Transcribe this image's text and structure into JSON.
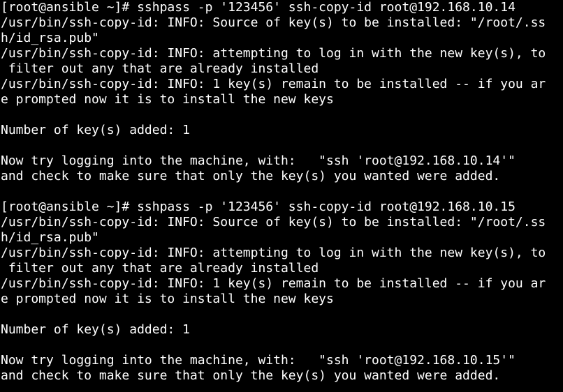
{
  "terminal": {
    "lines": [
      "[root@ansible ~]# sshpass -p '123456' ssh-copy-id root@192.168.10.14",
      "/usr/bin/ssh-copy-id: INFO: Source of key(s) to be installed: \"/root/.ss",
      "h/id_rsa.pub\"",
      "/usr/bin/ssh-copy-id: INFO: attempting to log in with the new key(s), to",
      " filter out any that are already installed",
      "/usr/bin/ssh-copy-id: INFO: 1 key(s) remain to be installed -- if you ar",
      "e prompted now it is to install the new keys",
      "",
      "Number of key(s) added: 1",
      "",
      "Now try logging into the machine, with:   \"ssh 'root@192.168.10.14'\"",
      "and check to make sure that only the key(s) you wanted were added.",
      "",
      "[root@ansible ~]# sshpass -p '123456' ssh-copy-id root@192.168.10.15",
      "/usr/bin/ssh-copy-id: INFO: Source of key(s) to be installed: \"/root/.ss",
      "h/id_rsa.pub\"",
      "/usr/bin/ssh-copy-id: INFO: attempting to log in with the new key(s), to",
      " filter out any that are already installed",
      "/usr/bin/ssh-copy-id: INFO: 1 key(s) remain to be installed -- if you ar",
      "e prompted now it is to install the new keys",
      "",
      "Number of key(s) added: 1",
      "",
      "Now try logging into the machine, with:   \"ssh 'root@192.168.10.15'\"",
      "and check to make sure that only the key(s) you wanted were added."
    ]
  },
  "colors": {
    "background": "#000000",
    "foreground": "#ffffff"
  }
}
